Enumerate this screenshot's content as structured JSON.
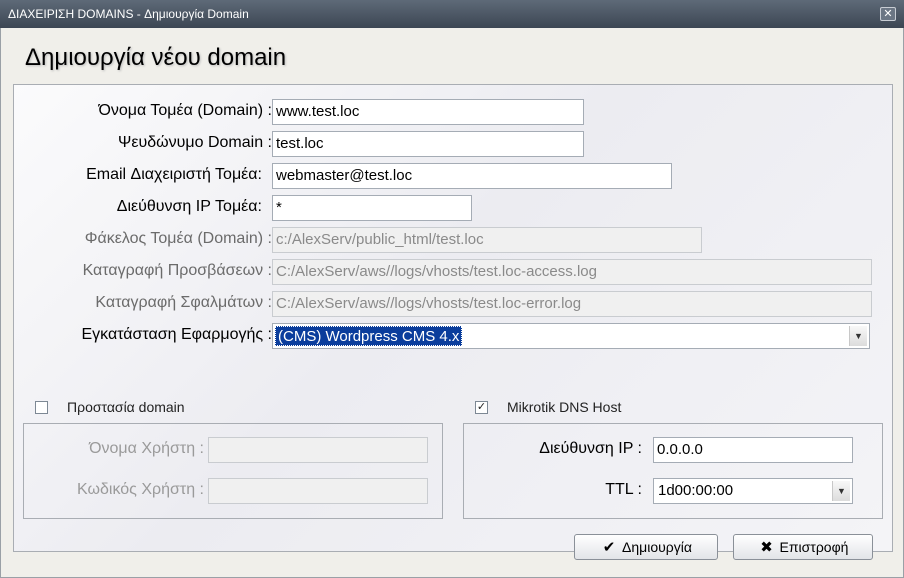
{
  "window": {
    "title": "ΔΙΑΧΕΙΡΙΣΗ DOMAINS - Δημιουργία Domain",
    "close_glyph": "✕"
  },
  "heading": "Δημιουργία νέου domain",
  "form": {
    "domain_name": {
      "label": "Όνομα Τομέα (Domain) :",
      "value": "www.test.loc"
    },
    "alias": {
      "label": "Ψευδώνυμο Domain :",
      "value": "test.loc"
    },
    "admin_email": {
      "label": "Email Διαχειριστή Τομέα:",
      "value": "webmaster@test.loc"
    },
    "ip_address": {
      "label": "Διεύθυνση IP Τομέα:",
      "value": "*"
    },
    "folder": {
      "label": "Φάκελος Τομέα (Domain) :",
      "value": "c:/AlexServ/public_html/test.loc"
    },
    "access_log": {
      "label": "Καταγραφή Προσβάσεων :",
      "value": "C:/AlexServ/aws//logs/vhosts/test.loc-access.log"
    },
    "error_log": {
      "label": "Καταγραφή Σφαλμάτων :",
      "value": "C:/AlexServ/aws//logs/vhosts/test.loc-error.log"
    },
    "app_install": {
      "label": "Εγκατάσταση Εφαρμογής :",
      "value": "(CMS)  Wordpress CMS 4.x"
    }
  },
  "protection": {
    "label": "Προστασία domain",
    "checked": false,
    "username_label": "Όνομα Χρήστη :",
    "username_value": "",
    "password_label": "Κωδικός Χρήστη :",
    "password_value": ""
  },
  "mikrotik": {
    "label": "Mikrotik DNS Host",
    "checked": true,
    "checkmark": "✓",
    "ip_label": "Διεύθυνση IP :",
    "ip_value": "0.0.0.0",
    "ttl_label": "TTL :",
    "ttl_value": "1d00:00:00"
  },
  "buttons": {
    "create_label": "Δημιουργία",
    "create_icon": "✔",
    "back_label": "Επιστροφή",
    "back_icon": "✖"
  },
  "icons": {
    "dropdown_arrow": "▼"
  }
}
